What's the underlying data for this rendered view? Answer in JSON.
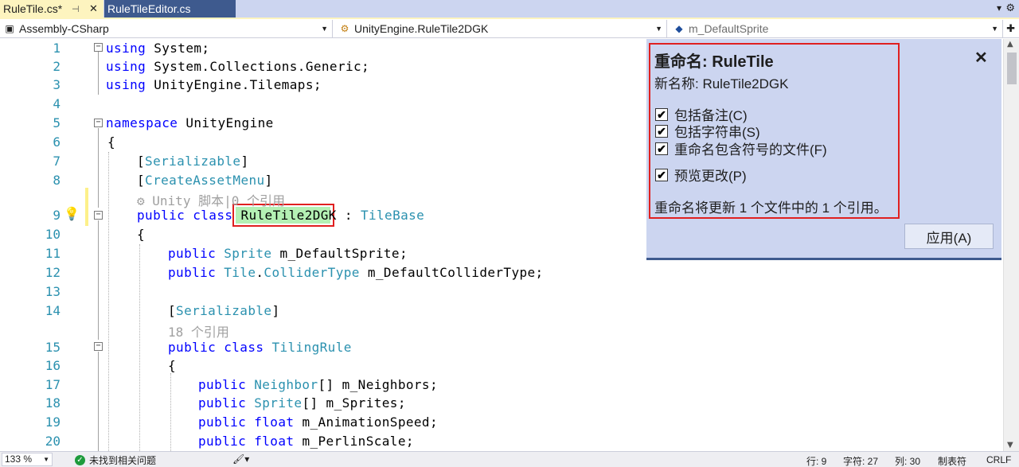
{
  "tabs": [
    {
      "label": "RuleTile.cs*",
      "active": true
    },
    {
      "label": "RuleTileEditor.cs",
      "active": false
    }
  ],
  "nav": {
    "project": "Assembly-CSharp",
    "type": "UnityEngine.RuleTile2DGK",
    "member": "m_DefaultSprite"
  },
  "editor": {
    "line_numbers": [
      "1",
      "2",
      "3",
      "4",
      "5",
      "6",
      "7",
      "8",
      "9",
      "10",
      "11",
      "12",
      "13",
      "14",
      "15",
      "16",
      "17",
      "18",
      "19",
      "20"
    ],
    "code": {
      "l1_kw": "using",
      "l1_rest": " System;",
      "l2_kw": "using",
      "l2_rest": " System.Collections.Generic;",
      "l3_kw": "using",
      "l3_rest": " UnityEngine.Tilemaps;",
      "l5_kw": "namespace",
      "l5_rest": " UnityEngine",
      "l6": "{",
      "l7_a": "[",
      "l7_b": "Serializable",
      "l7_c": "]",
      "l8_a": "[",
      "l8_b": "CreateAssetMenu",
      "l8_c": "]",
      "lens1": "Unity 脚本|0 个引用",
      "l9_kw": "public class ",
      "l9_name": "RuleTile2DGK",
      "l9_sep": " : ",
      "l9_base": "TileBase",
      "l10": "{",
      "l11_kw": "public ",
      "l11_ty": "Sprite",
      "l11_rest": " m_DefaultSprite;",
      "l12_kw": "public ",
      "l12_ty1": "Tile",
      "l12_dot": ".",
      "l12_ty2": "ColliderType",
      "l12_rest": " m_DefaultColliderType;",
      "l14_a": "[",
      "l14_b": "Serializable",
      "l14_c": "]",
      "lens2": "18 个引用",
      "l15_kw": "public class ",
      "l15_ty": "TilingRule",
      "l16": "{",
      "l17_kw": "public ",
      "l17_ty": "Neighbor",
      "l17_rest": "[] m_Neighbors;",
      "l18_kw": "public ",
      "l18_ty": "Sprite",
      "l18_rest": "[] m_Sprites;",
      "l19_kw": "public float",
      "l19_rest": " m_AnimationSpeed;",
      "l20_kw": "public float",
      "l20_rest": " m_PerlinScale;"
    }
  },
  "rename": {
    "title": "重命名: RuleTile",
    "new_name": "新名称: RuleTile2DGK",
    "options": [
      {
        "label": "包括备注(C)",
        "checked": true
      },
      {
        "label": "包括字符串(S)",
        "checked": true
      },
      {
        "label": "重命名包含符号的文件(F)",
        "checked": true
      },
      {
        "label": "预览更改(P)",
        "checked": true
      }
    ],
    "check_glyph": "✔",
    "summary": "重命名将更新 1 个文件中的 1 个引用。",
    "apply_label": "应用(A)",
    "close_glyph": "✕"
  },
  "status": {
    "zoom": "133 %",
    "issues": "未找到相关问题",
    "line": "行: 9",
    "char": "字符: 27",
    "col": "列: 30",
    "tab": "制表符",
    "eol": "CRLF"
  },
  "colors": {
    "keyword": "#0000ff",
    "type": "#2b91af",
    "line_number": "#2b91af",
    "panel_bg": "#ccd5f0",
    "tab_active": "#fdf4bf",
    "tab_inactive": "#3e5a8e",
    "highlight_border": "#e02020",
    "rename_highlight": "#b4f0b4"
  },
  "icons": [
    "pin-icon",
    "close-icon",
    "dropdown-icon",
    "gear-icon",
    "project-icon",
    "class-icon",
    "field-icon",
    "split-icon",
    "lightbulb-icon",
    "fold-icon",
    "checkmark-icon",
    "brush-icon"
  ]
}
